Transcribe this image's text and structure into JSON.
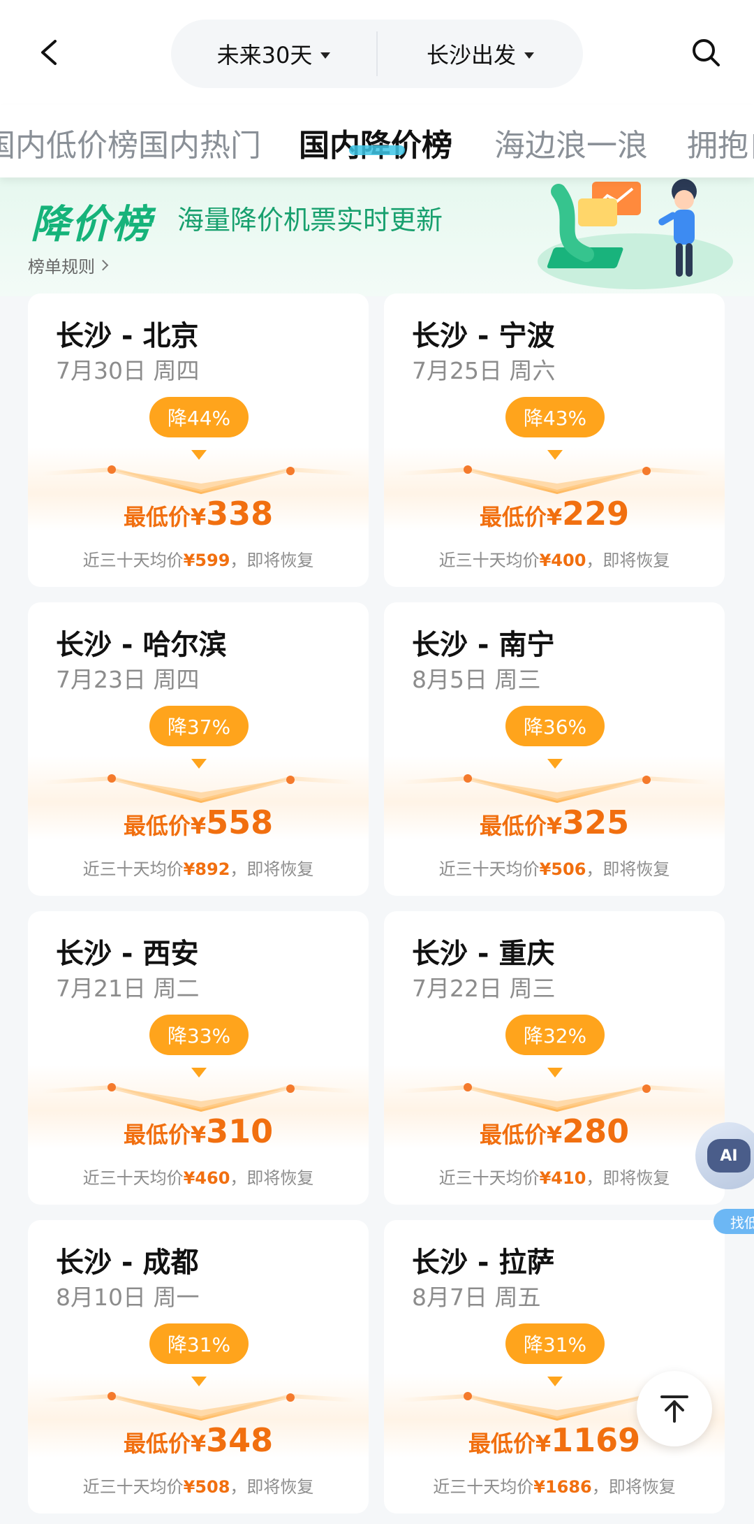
{
  "header": {
    "date_filter": "未来30天",
    "departure_filter": "长沙出发"
  },
  "tabs": [
    {
      "label": "国内低价榜"
    },
    {
      "label": "国内热门"
    },
    {
      "label": "国内降价榜",
      "active": true
    },
    {
      "label": "海边浪一浪"
    },
    {
      "label": "拥抱自然"
    }
  ],
  "banner": {
    "title": "降价榜",
    "subtitle": "海量降价机票实时更新",
    "rules_link": "榜单规则"
  },
  "card_text": {
    "price_label": "最低价¥",
    "avg_prefix": "近三十天均价",
    "avg_suffix": "，即将恢复"
  },
  "cards": [
    {
      "route": "长沙 - 北京",
      "date": "7月30日 周四",
      "drop": "降44%",
      "price": "338",
      "avg": "¥599"
    },
    {
      "route": "长沙 - 宁波",
      "date": "7月25日 周六",
      "drop": "降43%",
      "price": "229",
      "avg": "¥400"
    },
    {
      "route": "长沙 - 哈尔滨",
      "date": "7月23日 周四",
      "drop": "降37%",
      "price": "558",
      "avg": "¥892"
    },
    {
      "route": "长沙 - 南宁",
      "date": "8月5日 周三",
      "drop": "降36%",
      "price": "325",
      "avg": "¥506"
    },
    {
      "route": "长沙 - 西安",
      "date": "7月21日 周二",
      "drop": "降33%",
      "price": "310",
      "avg": "¥460"
    },
    {
      "route": "长沙 - 重庆",
      "date": "7月22日 周三",
      "drop": "降32%",
      "price": "280",
      "avg": "¥410"
    },
    {
      "route": "长沙 - 成都",
      "date": "8月10日 周一",
      "drop": "降31%",
      "price": "348",
      "avg": "¥508"
    },
    {
      "route": "长沙 - 拉萨",
      "date": "8月7日 周五",
      "drop": "降31%",
      "price": "1169",
      "avg": "¥1686"
    }
  ],
  "floating": {
    "ai_label": "AI",
    "ai_tag": "找低"
  },
  "colors": {
    "accent_orange": "#f16f0f",
    "badge_orange": "#ffa41c",
    "brand_green": "#16b37a"
  }
}
